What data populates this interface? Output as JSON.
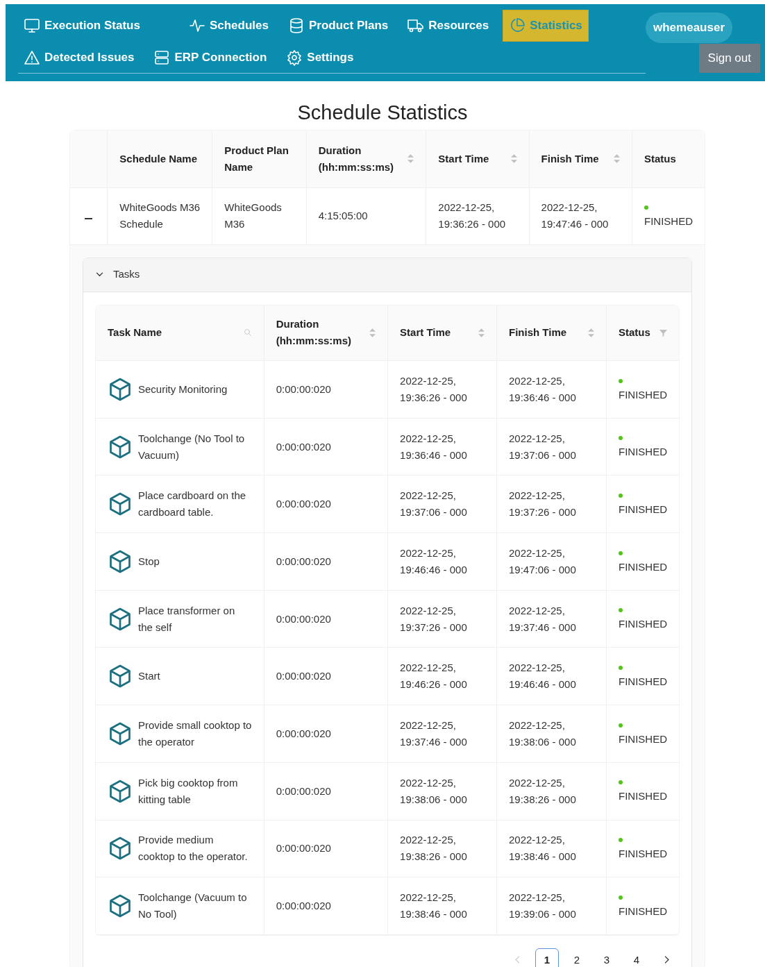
{
  "nav": {
    "items": [
      {
        "label": "Execution Status",
        "selected": false
      },
      {
        "label": "Schedules",
        "selected": false
      },
      {
        "label": "Product Plans",
        "selected": false
      },
      {
        "label": "Resources",
        "selected": false
      },
      {
        "label": "Statistics",
        "selected": true
      },
      {
        "label": "Detected Issues",
        "selected": false
      },
      {
        "label": "ERP Connection",
        "selected": false
      },
      {
        "label": "Settings",
        "selected": false
      }
    ],
    "user": "whemeauser",
    "sign_out": "Sign out"
  },
  "title": "Schedule Statistics",
  "schedule_table": {
    "columns": [
      "Schedule Name",
      "Product Plan Name",
      "Duration (hh:mm:ss:ms)",
      "Start Time",
      "Finish Time",
      "Status"
    ],
    "rows": [
      {
        "expanded": true,
        "schedule_name": "WhiteGoods M36 Schedule",
        "product_plan": "WhiteGoods M36",
        "duration": "4:15:05:00",
        "start": "2022-12-25, 19:36:26 - 000",
        "finish": "2022-12-25, 19:47:46 - 000",
        "status": "FINISHED",
        "color": "#52c41a"
      }
    ]
  },
  "tasks_panel": {
    "title": "Tasks",
    "expanded": true,
    "columns": [
      "Task Name",
      "Duration (hh:mm:ss:ms)",
      "Start Time",
      "Finish Time",
      "Status"
    ],
    "rows": [
      {
        "name": "Security Monitoring",
        "duration": "0:00:00:020",
        "start": "2022-12-25, 19:36:26 - 000",
        "finish": "2022-12-25, 19:36:46 - 000",
        "status": "FINISHED",
        "color": "#52c41a"
      },
      {
        "name": "Toolchange (No Tool to Vacuum)",
        "duration": "0:00:00:020",
        "start": "2022-12-25, 19:36:46 - 000",
        "finish": "2022-12-25, 19:37:06 - 000",
        "status": "FINISHED",
        "color": "#52c41a"
      },
      {
        "name": "Place cardboard on the cardboard table.",
        "duration": "0:00:00:020",
        "start": "2022-12-25, 19:37:06 - 000",
        "finish": "2022-12-25, 19:37:26 - 000",
        "status": "FINISHED",
        "color": "#52c41a"
      },
      {
        "name": "Stop",
        "duration": "0:00:00:020",
        "start": "2022-12-25, 19:46:46 - 000",
        "finish": "2022-12-25, 19:47:06 - 000",
        "status": "FINISHED",
        "color": "#52c41a"
      },
      {
        "name": "Place transformer on the self",
        "duration": "0:00:00:020",
        "start": "2022-12-25, 19:37:26 - 000",
        "finish": "2022-12-25, 19:37:46 - 000",
        "status": "FINISHED",
        "color": "#52c41a"
      },
      {
        "name": "Start",
        "duration": "0:00:00:020",
        "start": "2022-12-25, 19:46:26 - 000",
        "finish": "2022-12-25, 19:46:46 - 000",
        "status": "FINISHED",
        "color": "#52c41a"
      },
      {
        "name": "Provide small cooktop to the operator",
        "duration": "0:00:00:020",
        "start": "2022-12-25, 19:37:46 - 000",
        "finish": "2022-12-25, 19:38:06 - 000",
        "status": "FINISHED",
        "color": "#52c41a"
      },
      {
        "name": "Pick big cooktop from kitting table",
        "duration": "0:00:00:020",
        "start": "2022-12-25, 19:38:06 - 000",
        "finish": "2022-12-25, 19:38:26 - 000",
        "status": "FINISHED",
        "color": "#52c41a"
      },
      {
        "name": "Provide medium cooktop to the operator.",
        "duration": "0:00:00:020",
        "start": "2022-12-25, 19:38:26 - 000",
        "finish": "2022-12-25, 19:38:46 - 000",
        "status": "FINISHED",
        "color": "#52c41a"
      },
      {
        "name": "Toolchange (Vacuum to No Tool)",
        "duration": "0:00:00:020",
        "start": "2022-12-25, 19:38:46 - 000",
        "finish": "2022-12-25, 19:39:06 - 000",
        "status": "FINISHED",
        "color": "#52c41a"
      }
    ],
    "pagination": {
      "prev_disabled": true,
      "pages": [
        {
          "label": "1",
          "selected": true
        },
        {
          "label": "2",
          "selected": false
        },
        {
          "label": "3",
          "selected": false
        },
        {
          "label": "4",
          "selected": false
        }
      ]
    }
  }
}
